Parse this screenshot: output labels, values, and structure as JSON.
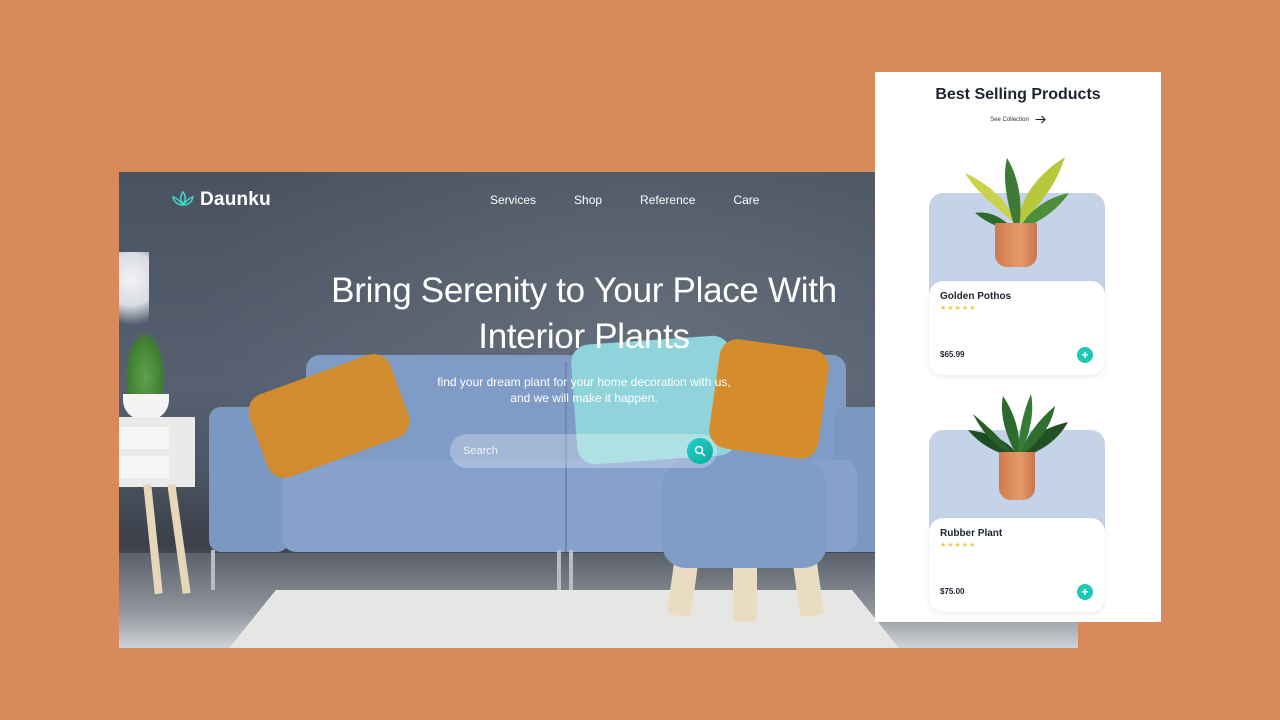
{
  "nav": {
    "brand": "Daunku",
    "links": [
      "Services",
      "Shop",
      "Reference",
      "Care"
    ]
  },
  "hero": {
    "headline_line1": "Bring Serenity to Your Place With",
    "headline_line2": "Interior Plants",
    "subline_line1": "find your dream plant for your home decoration with us,",
    "subline_line2": "and we will make it happen.",
    "search_placeholder": "Search"
  },
  "panel": {
    "title": "Best Selling Products",
    "see_collection": "See Collection",
    "products": [
      {
        "name": "Golden Pothos",
        "stars": "★★★★★",
        "price": "$65.99",
        "rating": 5
      },
      {
        "name": "Rubber Plant",
        "stars": "★★★★★",
        "price": "$75.00",
        "rating": 5
      }
    ]
  },
  "colors": {
    "background": "#d98a5b",
    "accent": "#1ec8b4",
    "card_bg": "#c5d3e8",
    "star": "#f2c94c"
  },
  "icons": [
    "lotus-logo-icon",
    "search-icon",
    "arrow-right-icon",
    "plus-icon"
  ]
}
